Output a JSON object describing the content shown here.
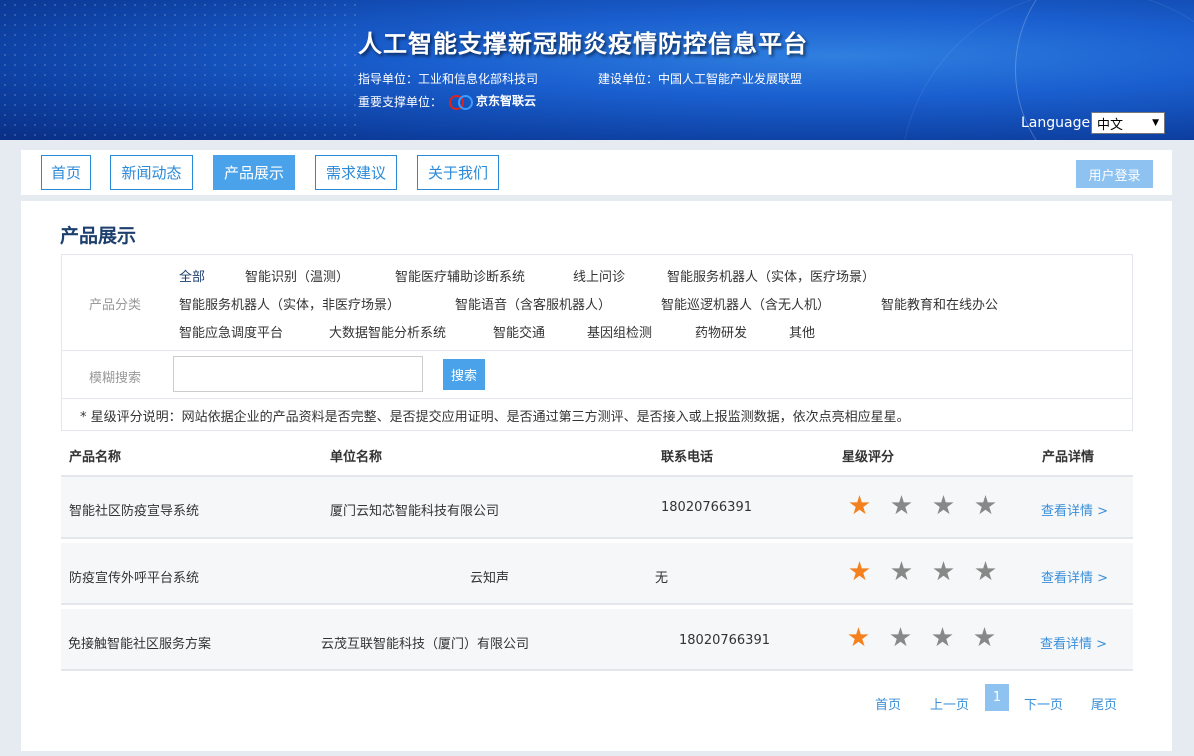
{
  "header": {
    "title": "人工智能支撑新冠肺炎疫情防控信息平台",
    "guide_unit": "指导单位：工业和信息化部科技司",
    "build_unit": "建设单位：中国人工智能产业发展联盟",
    "support_label": "重要支撑单位：",
    "support_logo_text": "京东智联云",
    "language_label": "Language",
    "language_value": "中文"
  },
  "nav": {
    "items": [
      {
        "label": "首页"
      },
      {
        "label": "新闻动态"
      },
      {
        "label": "产品展示"
      },
      {
        "label": "需求建议"
      },
      {
        "label": "关于我们"
      }
    ],
    "active_index": 2,
    "login_label": "用户登录"
  },
  "page": {
    "title": "产品展示",
    "category_label": "产品分类",
    "categories": [
      "全部",
      "智能识别（温测）",
      "智能医疗辅助诊断系统",
      "线上问诊",
      "智能服务机器人（实体，医疗场景）",
      "智能服务机器人（实体，非医疗场景）",
      "智能语音（含客服机器人）",
      "智能巡逻机器人（含无人机）",
      "智能教育和在线办公",
      "智能应急调度平台",
      "大数据智能分析系统",
      "智能交通",
      "基因组检测",
      "药物研发",
      "其他"
    ],
    "search_label": "模糊搜索",
    "search_value": "",
    "search_placeholder": "",
    "search_button": "搜索",
    "rating_note": "* 星级评分说明：网站依据企业的产品资料是否完整、是否提交应用证明、是否通过第三方测评、是否接入或上报监测数据，依次点亮相应星星。"
  },
  "table": {
    "headers": [
      "产品名称",
      "单位名称",
      "联系电话",
      "星级评分",
      "产品详情"
    ],
    "rows": [
      {
        "name": "智能社区防疫宣导系统",
        "company": "厦门云知芯智能科技有限公司",
        "phone": "18020766391",
        "stars": 1,
        "detail": "查看详情 >"
      },
      {
        "name": "防疫宣传外呼平台系统",
        "company": "云知声",
        "phone": "无",
        "stars": 1,
        "detail": "查看详情 >"
      },
      {
        "name": "免接触智能社区服务方案",
        "company": "云茂互联智能科技（厦门）有限公司",
        "phone": "18020766391",
        "stars": 1,
        "detail": "查看详情 >"
      }
    ],
    "max_stars": 4,
    "colors": {
      "star_on": "#f5801e",
      "star_off": "#888888"
    }
  },
  "pagination": {
    "first": "首页",
    "prev": "上一页",
    "current": "1",
    "next": "下一页",
    "last": "尾页"
  },
  "colors": {
    "accent": "#4aa3ea",
    "link": "#3a8fd9",
    "title": "#1d3f6e"
  }
}
